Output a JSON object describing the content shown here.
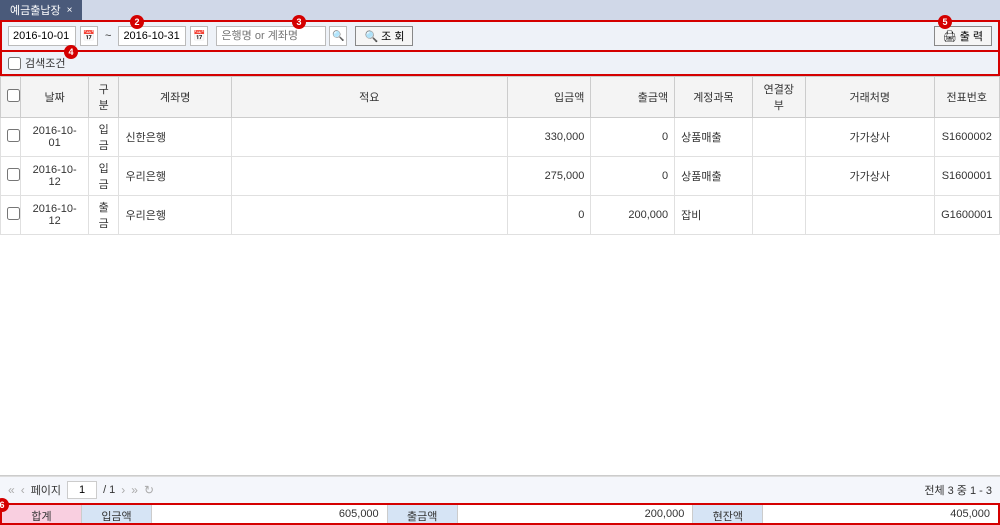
{
  "tab_title": "예금출납장",
  "toolbar": {
    "date_from": "2016-10-01",
    "date_to": "2016-10-31",
    "search_placeholder": "은행명 or 계좌명",
    "search_btn": "조 회",
    "print_btn": "출 력",
    "cond_label": "검색조건"
  },
  "table": {
    "headers": {
      "chk": "",
      "date": "날짜",
      "type": "구분",
      "acct": "계좌명",
      "desc": "적요",
      "in": "입금액",
      "out": "출금액",
      "cat": "계정과목",
      "link": "연결장부",
      "vendor": "거래처명",
      "slip": "전표번호"
    },
    "rows": [
      {
        "date": "2016-10-01",
        "type": "입금",
        "acct": "신한은행",
        "desc": "",
        "in": "330,000",
        "out": "0",
        "cat": "상품매출",
        "link": "",
        "vendor": "가가상사",
        "slip": "S1600002"
      },
      {
        "date": "2016-10-12",
        "type": "입금",
        "acct": "우리은행",
        "desc": "",
        "in": "275,000",
        "out": "0",
        "cat": "상품매출",
        "link": "",
        "vendor": "가가상사",
        "slip": "S1600001"
      },
      {
        "date": "2016-10-12",
        "type": "출금",
        "acct": "우리은행",
        "desc": "",
        "in": "0",
        "out": "200,000",
        "cat": "잡비",
        "link": "",
        "vendor": "",
        "slip": "G1600001"
      }
    ]
  },
  "pager": {
    "label": "페이지",
    "current": "1",
    "total": "/ 1",
    "info": "전체 3 중 1 - 3"
  },
  "summary": {
    "total_label": "합계",
    "in_label": "입금액",
    "in_value": "605,000",
    "out_label": "출금액",
    "out_value": "200,000",
    "bal_label": "현잔액",
    "bal_value": "405,000"
  },
  "badges": {
    "b2": "2",
    "b3": "3",
    "b4": "4",
    "b5": "5",
    "b6": "6"
  }
}
